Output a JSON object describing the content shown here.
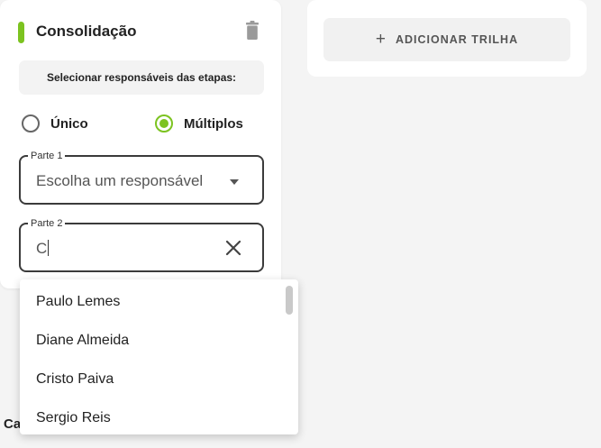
{
  "card": {
    "title": "Consolidação",
    "instruction": "Selecionar responsáveis das etapas:",
    "radio_options": [
      {
        "label": "Único",
        "selected": false
      },
      {
        "label": "Múltiplos",
        "selected": true
      }
    ],
    "fields": [
      {
        "legend": "Parte 1",
        "value": "Escolha um responsável"
      },
      {
        "legend": "Parte 2",
        "value": "C"
      }
    ]
  },
  "add_trail": {
    "icon": "plus",
    "label": "ADICIONAR TRILHA"
  },
  "background_text": "Ca",
  "dropdown": {
    "options": [
      "Paulo Lemes",
      "Diane Almeida",
      "Cristo Paiva",
      "Sergio Reis"
    ]
  },
  "colors": {
    "accent": "#7cc320",
    "card": "#ffffff",
    "background": "#f4f4f4"
  }
}
